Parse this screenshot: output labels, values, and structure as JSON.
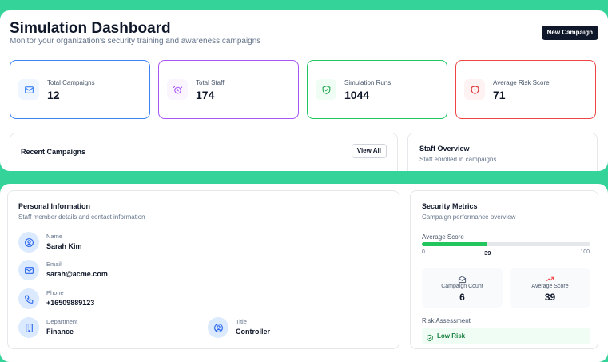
{
  "header": {
    "title": "Simulation Dashboard",
    "subtitle": "Monitor your organization's security training and awareness campaigns",
    "new_campaign_label": "New Campaign"
  },
  "stats": [
    {
      "label": "Total Campaigns",
      "value": "12",
      "icon": "mail-icon",
      "color": "#3b82f6"
    },
    {
      "label": "Total Staff",
      "value": "174",
      "icon": "alarm-icon",
      "color": "#a855f7"
    },
    {
      "label": "Simulation Runs",
      "value": "1044",
      "icon": "shield-check-icon",
      "color": "#22c55e"
    },
    {
      "label": "Average Risk Score",
      "value": "71",
      "icon": "shield-alert-icon",
      "color": "#ef4444"
    }
  ],
  "recent_campaigns": {
    "title": "Recent Campaigns",
    "view_all_label": "View All"
  },
  "staff_overview": {
    "title": "Staff Overview",
    "subtitle": "Staff enrolled in campaigns"
  },
  "personal_info": {
    "title": "Personal Information",
    "subtitle": "Staff member details and contact information",
    "name_label": "Name",
    "name": "Sarah Kim",
    "email_label": "Email",
    "email": "sarah@acme.com",
    "phone_label": "Phone",
    "phone": "+16509889123",
    "department_label": "Department",
    "department": "Finance",
    "title_label": "Title",
    "job_title": "Controller"
  },
  "security_metrics": {
    "title": "Security Metrics",
    "subtitle": "Campaign performance overview",
    "avg_score_label": "Average Score",
    "score": 39,
    "score_text": "39",
    "scale_min": "0",
    "scale_max": "100",
    "campaign_count_label": "Campaign Count",
    "campaign_count": "6",
    "average_score_label": "Average Score",
    "average_score": "39",
    "risk_assessment_label": "Risk Assessment",
    "risk_level": "Low Risk"
  },
  "colors": {
    "accent": "#22c55e",
    "background": "#34d399",
    "dark_button": "#0f172a"
  }
}
